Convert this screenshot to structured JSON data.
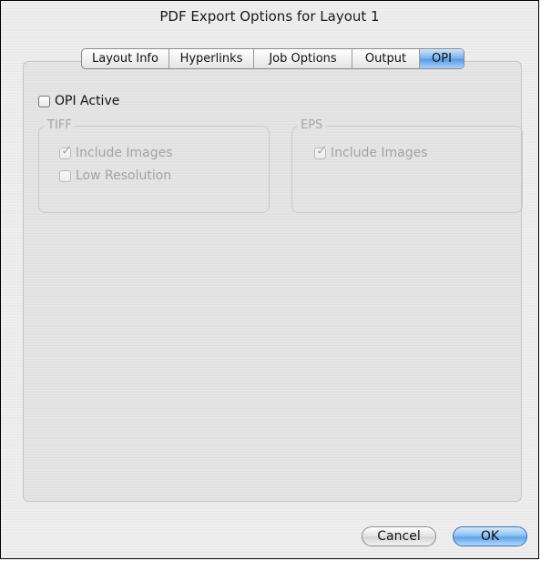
{
  "dialog": {
    "title": "PDF Export Options for Layout 1"
  },
  "tabs": [
    {
      "label": "Layout Info",
      "active": false
    },
    {
      "label": "Hyperlinks",
      "active": false
    },
    {
      "label": "Job Options",
      "active": false
    },
    {
      "label": "Output",
      "active": false
    },
    {
      "label": "OPI",
      "active": true
    }
  ],
  "opi": {
    "active_label": "OPI Active",
    "active_checked": false,
    "tiff": {
      "title": "TIFF",
      "include_images_label": "Include Images",
      "include_images_checked": true,
      "low_resolution_label": "Low Resolution",
      "low_resolution_checked": false
    },
    "eps": {
      "title": "EPS",
      "include_images_label": "Include Images",
      "include_images_checked": true
    }
  },
  "buttons": {
    "cancel": "Cancel",
    "ok": "OK"
  },
  "colors": {
    "accent": "#5a9ce6",
    "disabled_text": "#a4a4a4"
  }
}
